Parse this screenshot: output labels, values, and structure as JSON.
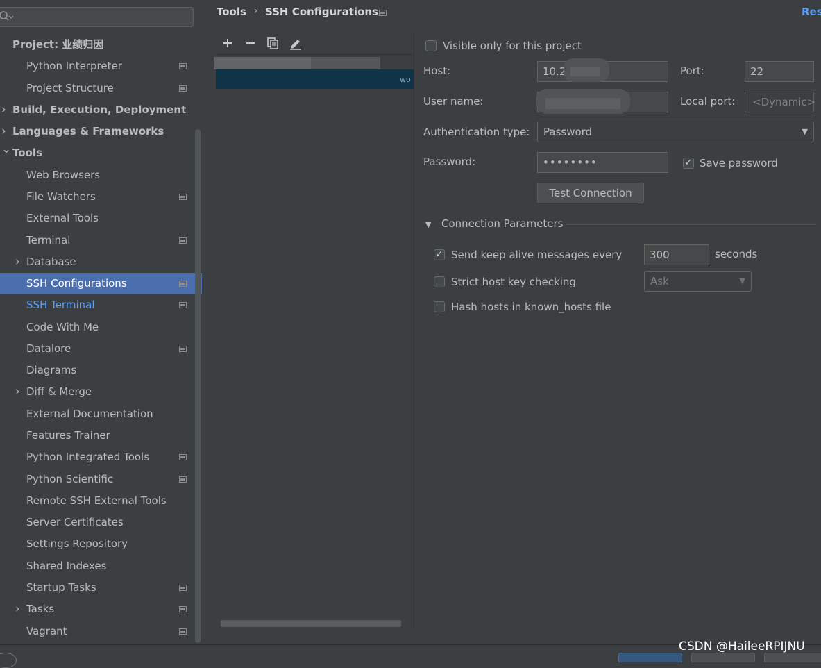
{
  "sidebar": {
    "search": {
      "placeholder": "",
      "icon": "search-icon"
    },
    "items": [
      {
        "label": "Project: 业绩归因",
        "level": 0,
        "bold": true,
        "expandable": false,
        "has_project_icon": false
      },
      {
        "label": "Python Interpreter",
        "level": 1,
        "bold": false,
        "expandable": false,
        "has_project_icon": true
      },
      {
        "label": "Project Structure",
        "level": 1,
        "bold": false,
        "expandable": false,
        "has_project_icon": true
      },
      {
        "label": "Build, Execution, Deployment",
        "level": 0,
        "bold": true,
        "expandable": true,
        "expanded": false,
        "has_project_icon": false
      },
      {
        "label": "Languages & Frameworks",
        "level": 0,
        "bold": true,
        "expandable": true,
        "expanded": false,
        "has_project_icon": false
      },
      {
        "label": "Tools",
        "level": 0,
        "bold": true,
        "expandable": true,
        "expanded": true,
        "has_project_icon": false
      },
      {
        "label": "Web Browsers",
        "level": 1,
        "bold": false,
        "expandable": false,
        "has_project_icon": false
      },
      {
        "label": "File Watchers",
        "level": 1,
        "bold": false,
        "expandable": false,
        "has_project_icon": true
      },
      {
        "label": "External Tools",
        "level": 1,
        "bold": false,
        "expandable": false,
        "has_project_icon": false
      },
      {
        "label": "Terminal",
        "level": 1,
        "bold": false,
        "expandable": false,
        "has_project_icon": true
      },
      {
        "label": "Database",
        "level": 1,
        "bold": false,
        "expandable": true,
        "expanded": false,
        "has_project_icon": false
      },
      {
        "label": "SSH Configurations",
        "level": 1,
        "bold": false,
        "expandable": false,
        "has_project_icon": true,
        "selected": true
      },
      {
        "label": "SSH Terminal",
        "level": 1,
        "bold": false,
        "expandable": false,
        "has_project_icon": true,
        "highlight": true
      },
      {
        "label": "Code With Me",
        "level": 1,
        "bold": false,
        "expandable": false,
        "has_project_icon": false
      },
      {
        "label": "Datalore",
        "level": 1,
        "bold": false,
        "expandable": false,
        "has_project_icon": true
      },
      {
        "label": "Diagrams",
        "level": 1,
        "bold": false,
        "expandable": false,
        "has_project_icon": false
      },
      {
        "label": "Diff & Merge",
        "level": 1,
        "bold": false,
        "expandable": true,
        "expanded": false,
        "has_project_icon": false
      },
      {
        "label": "External Documentation",
        "level": 1,
        "bold": false,
        "expandable": false,
        "has_project_icon": false
      },
      {
        "label": "Features Trainer",
        "level": 1,
        "bold": false,
        "expandable": false,
        "has_project_icon": false
      },
      {
        "label": "Python Integrated Tools",
        "level": 1,
        "bold": false,
        "expandable": false,
        "has_project_icon": true
      },
      {
        "label": "Python Scientific",
        "level": 1,
        "bold": false,
        "expandable": false,
        "has_project_icon": true
      },
      {
        "label": "Remote SSH External Tools",
        "level": 1,
        "bold": false,
        "expandable": false,
        "has_project_icon": false
      },
      {
        "label": "Server Certificates",
        "level": 1,
        "bold": false,
        "expandable": false,
        "has_project_icon": false
      },
      {
        "label": "Settings Repository",
        "level": 1,
        "bold": false,
        "expandable": false,
        "has_project_icon": false
      },
      {
        "label": "Shared Indexes",
        "level": 1,
        "bold": false,
        "expandable": false,
        "has_project_icon": false
      },
      {
        "label": "Startup Tasks",
        "level": 1,
        "bold": false,
        "expandable": false,
        "has_project_icon": true
      },
      {
        "label": "Tasks",
        "level": 1,
        "bold": false,
        "expandable": true,
        "expanded": false,
        "has_project_icon": true
      },
      {
        "label": "Vagrant",
        "level": 1,
        "bold": false,
        "expandable": false,
        "has_project_icon": true
      }
    ]
  },
  "header": {
    "breadcrumb": [
      "Tools",
      "SSH Configurations"
    ],
    "separator": "›",
    "reset_label": "Reset"
  },
  "list_toolbar": {
    "add_icon": "plus-icon",
    "remove_icon": "minus-icon",
    "copy_icon": "copy-icon",
    "edit_icon": "pencil-icon"
  },
  "form": {
    "visible_only_label": "Visible only for this project",
    "visible_only_checked": false,
    "host_label": "Host:",
    "host_value": "10.2",
    "port_label": "Port:",
    "port_value": "22",
    "username_label": "User name:",
    "username_value": "",
    "local_port_label": "Local port:",
    "local_port_placeholder": "<Dynamic>",
    "auth_type_label": "Authentication type:",
    "auth_type_value": "Password",
    "password_label": "Password:",
    "password_value": "••••••••",
    "save_password_label": "Save password",
    "save_password_checked": true,
    "test_connection_label": "Test Connection"
  },
  "connection_parameters": {
    "title": "Connection Parameters",
    "expanded": true,
    "keep_alive_label": "Send keep alive messages every",
    "keep_alive_checked": true,
    "keep_alive_value": "300",
    "keep_alive_unit": "seconds",
    "strict_host_label": "Strict host key checking",
    "strict_host_checked": false,
    "strict_host_value": "Ask",
    "hash_hosts_label": "Hash hosts in known_hosts file",
    "hash_hosts_checked": false
  },
  "watermark": "CSDN @HaileeRPIJNU",
  "colors": {
    "background": "#3c3f41",
    "selection": "#4b6eaf",
    "link": "#589df6",
    "text": "#bbbbbb"
  }
}
